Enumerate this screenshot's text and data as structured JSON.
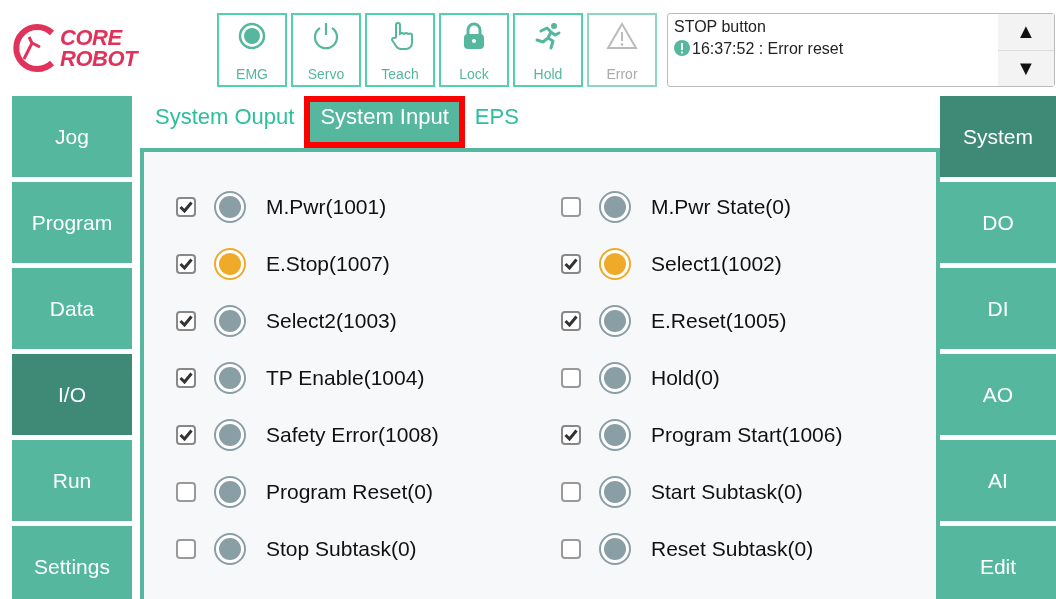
{
  "logo": {
    "line_1": "CORE",
    "line_2": "ROBOT"
  },
  "toolbar": [
    {
      "kind": "emg",
      "label": "EMG",
      "disabled": false
    },
    {
      "kind": "servo",
      "label": "Servo",
      "disabled": false
    },
    {
      "kind": "teach",
      "label": "Teach",
      "disabled": false
    },
    {
      "kind": "lock",
      "label": "Lock",
      "disabled": false
    },
    {
      "kind": "hold",
      "label": "Hold",
      "disabled": false
    },
    {
      "kind": "error",
      "label": "Error",
      "disabled": true
    }
  ],
  "message": {
    "title": "STOP button",
    "text": "16:37:52 : Error reset",
    "up": "▲",
    "down": "▼"
  },
  "left_nav": [
    {
      "label": "Jog",
      "selected": false
    },
    {
      "label": "Program",
      "selected": false
    },
    {
      "label": "Data",
      "selected": false
    },
    {
      "label": "I/O",
      "selected": true
    },
    {
      "label": "Run",
      "selected": false
    },
    {
      "label": "Settings",
      "selected": false
    }
  ],
  "tabs": [
    {
      "label": "System Ouput",
      "selected": false,
      "highlighted": false
    },
    {
      "label": "System Input",
      "selected": true,
      "highlighted": true
    },
    {
      "label": "EPS",
      "selected": false,
      "highlighted": false
    }
  ],
  "signals": [
    {
      "label": "M.Pwr(1001)",
      "checked": true,
      "on": false
    },
    {
      "label": "M.Pwr State(0)",
      "checked": false,
      "on": false
    },
    {
      "label": "E.Stop(1007)",
      "checked": true,
      "on": true
    },
    {
      "label": "Select1(1002)",
      "checked": true,
      "on": true
    },
    {
      "label": "Select2(1003)",
      "checked": true,
      "on": false
    },
    {
      "label": "E.Reset(1005)",
      "checked": true,
      "on": false
    },
    {
      "label": "TP Enable(1004)",
      "checked": true,
      "on": false
    },
    {
      "label": "Hold(0)",
      "checked": false,
      "on": false
    },
    {
      "label": "Safety Error(1008)",
      "checked": true,
      "on": false
    },
    {
      "label": "Program Start(1006)",
      "checked": true,
      "on": false
    },
    {
      "label": "Program Reset(0)",
      "checked": false,
      "on": false
    },
    {
      "label": "Start Subtask(0)",
      "checked": false,
      "on": false
    },
    {
      "label": "Stop Subtask(0)",
      "checked": false,
      "on": false
    },
    {
      "label": "Reset Subtask(0)",
      "checked": false,
      "on": false
    }
  ],
  "right_nav": [
    {
      "label": "System",
      "selected": true
    },
    {
      "label": "DO",
      "selected": false
    },
    {
      "label": "DI",
      "selected": false
    },
    {
      "label": "AO",
      "selected": false
    },
    {
      "label": "AI",
      "selected": false
    },
    {
      "label": "Edit",
      "selected": false
    }
  ]
}
